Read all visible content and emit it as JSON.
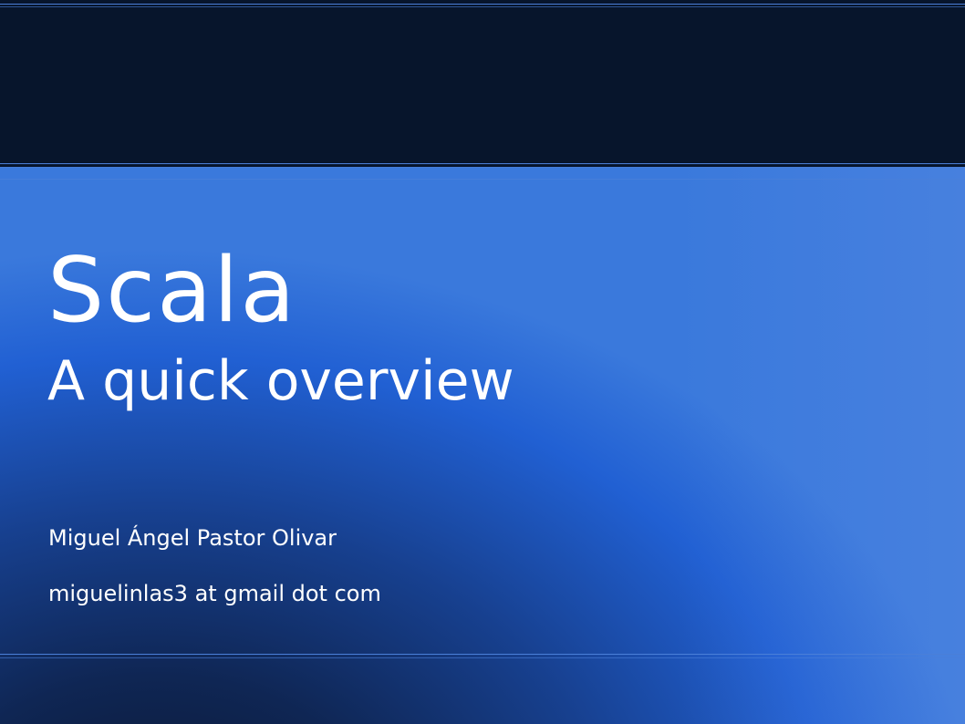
{
  "slide": {
    "title": "Scala",
    "subtitle": "A quick overview",
    "author": "Miguel Ángel Pastor Olivar",
    "email": "miguelinlas3 at gmail dot com"
  },
  "colors": {
    "top_band": "#07152c",
    "accent_line": "#4a7fd8",
    "gradient_dark": "#0a1630",
    "gradient_mid": "#17408f",
    "gradient_light": "#2160d3",
    "text": "#ffffff"
  }
}
